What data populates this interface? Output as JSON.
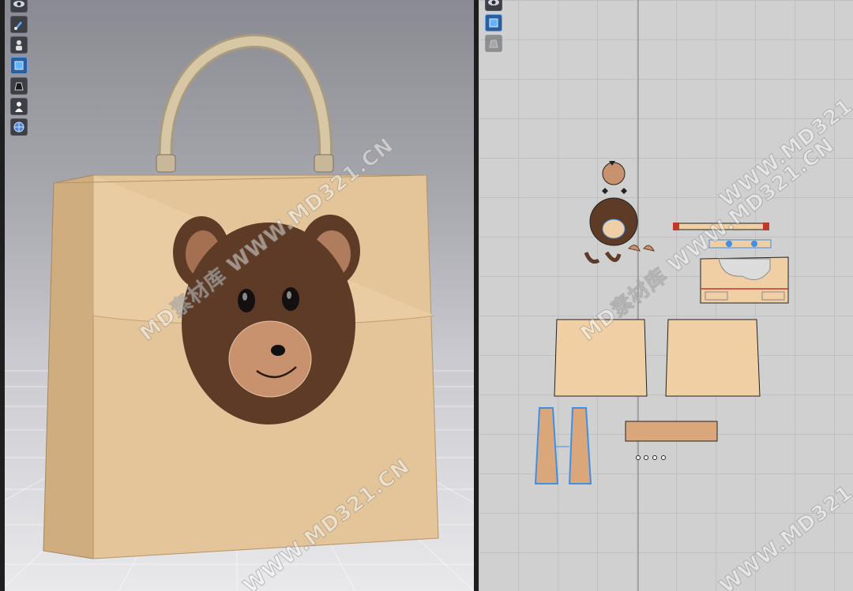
{
  "toolbar_3d": {
    "tools": [
      {
        "icon": "eye-icon",
        "state": "normal"
      },
      {
        "icon": "brush-icon",
        "state": "normal"
      },
      {
        "icon": "avatar-icon",
        "state": "normal"
      },
      {
        "icon": "fabric-icon",
        "state": "active"
      },
      {
        "icon": "garment-icon",
        "state": "normal"
      },
      {
        "icon": "silhouette-icon",
        "state": "normal"
      },
      {
        "icon": "globe-icon",
        "state": "normal"
      }
    ]
  },
  "toolbar_2d": {
    "tools": [
      {
        "icon": "eye-icon",
        "state": "normal"
      },
      {
        "icon": "fabric-icon",
        "state": "active"
      },
      {
        "icon": "garment-icon",
        "state": "disabled"
      }
    ]
  },
  "colors": {
    "bag_front": "#e4c59a",
    "bag_side": "#cfad7f",
    "bear_face": "#5d3b26",
    "bear_ear_inner": "#b07c5e",
    "bear_muzzle": "#c9926e",
    "pattern_fill": "#f0cfa4",
    "pattern_dark": "#d9a77a",
    "selection_blue": "#3f8fe6"
  },
  "watermarks": [
    {
      "text": "MD素材库 WWW.MD321.CN"
    },
    {
      "text": "WWW.MD321.CN"
    },
    {
      "text": "MD素材库 WWW.MD321.CN"
    },
    {
      "text": "WWW.MD321.CN"
    },
    {
      "text": "WWW.MD321.CN"
    }
  ]
}
